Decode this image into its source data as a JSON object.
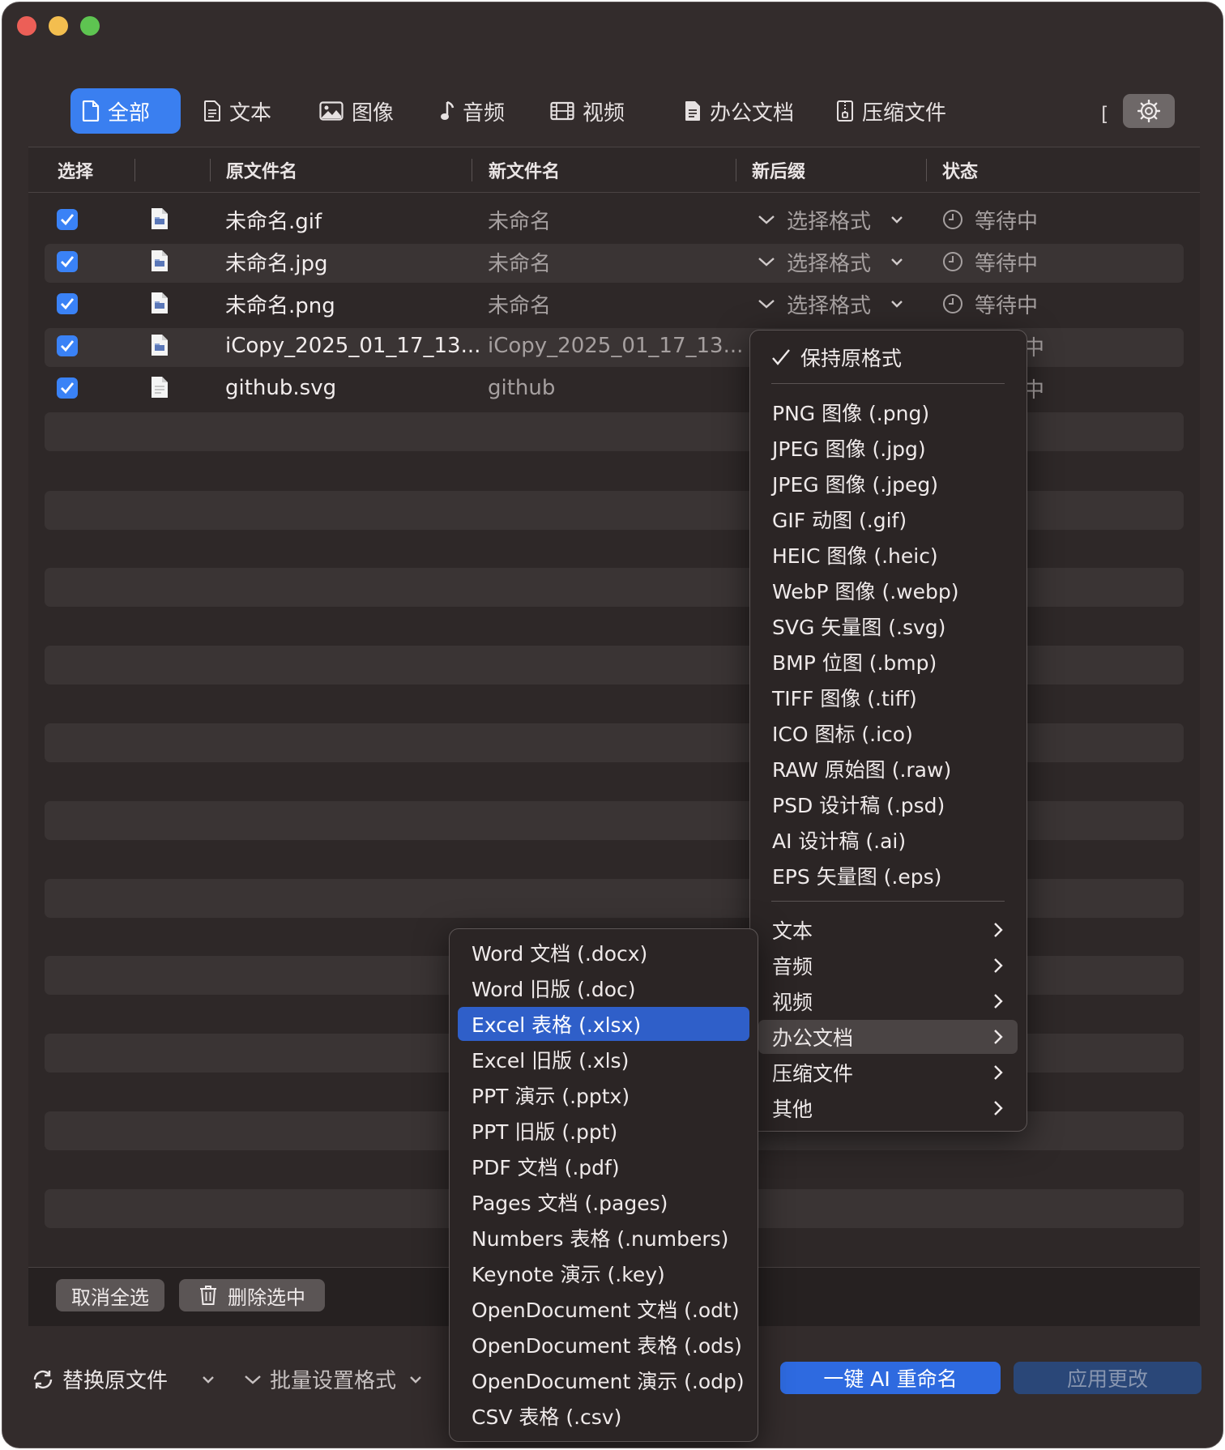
{
  "tabs": [
    {
      "label": "全部",
      "icon": "doc-icon",
      "active": true
    },
    {
      "label": "文本",
      "icon": "text-doc-icon"
    },
    {
      "label": "图像",
      "icon": "image-icon"
    },
    {
      "label": "音频",
      "icon": "music-note-icon"
    },
    {
      "label": "视频",
      "icon": "film-icon"
    },
    {
      "label": "办公文档",
      "icon": "office-doc-icon"
    },
    {
      "label": "压缩文件",
      "icon": "zip-icon"
    }
  ],
  "tab_overflow": "[",
  "columns": {
    "select": "选择",
    "original": "原文件名",
    "new_name": "新文件名",
    "suffix": "新后缀",
    "status": "状态"
  },
  "rows": [
    {
      "checked": true,
      "original": "未命名.gif",
      "new_name": "未命名",
      "suffix": "选择格式",
      "status": "等待中"
    },
    {
      "checked": true,
      "original": "未命名.jpg",
      "new_name": "未命名",
      "suffix": "选择格式",
      "status": "等待中"
    },
    {
      "checked": true,
      "original": "未命名.png",
      "new_name": "未命名",
      "suffix": "选择格式",
      "status": "等待中"
    },
    {
      "checked": true,
      "original": "iCopy_2025_01_17_13...",
      "new_name": "iCopy_2025_01_17_13...",
      "status_partial": "中"
    },
    {
      "checked": true,
      "original": "github.svg",
      "new_name": "github",
      "status_partial": "中"
    }
  ],
  "bottom_bar": {
    "deselect_all": "取消全选",
    "delete_selected": "删除选中"
  },
  "footer": {
    "replace_original": "替换原文件",
    "batch_format": "批量设置格式",
    "ai_rename": "一键 AI 重命名",
    "apply_changes": "应用更改"
  },
  "format_menu": {
    "keep_original": "保持原格式",
    "image_formats": [
      "PNG 图像 (.png)",
      "JPEG 图像 (.jpg)",
      "JPEG 图像 (.jpeg)",
      "GIF 动图 (.gif)",
      "HEIC 图像 (.heic)",
      "WebP 图像 (.webp)",
      "SVG 矢量图 (.svg)",
      "BMP 位图 (.bmp)",
      "TIFF 图像 (.tiff)",
      "ICO 图标 (.ico)",
      "RAW 原始图 (.raw)",
      "PSD 设计稿 (.psd)",
      "AI 设计稿 (.ai)",
      "EPS 矢量图 (.eps)"
    ],
    "categories": [
      "文本",
      "音频",
      "视频",
      "办公文档",
      "压缩文件",
      "其他"
    ],
    "hovered_category": "办公文档"
  },
  "office_submenu": {
    "items": [
      "Word 文档 (.docx)",
      "Word 旧版 (.doc)",
      "Excel 表格 (.xlsx)",
      "Excel 旧版 (.xls)",
      "PPT 演示 (.pptx)",
      "PPT 旧版 (.ppt)",
      "PDF 文档 (.pdf)",
      "Pages 文档 (.pages)",
      "Numbers 表格 (.numbers)",
      "Keynote 演示 (.key)",
      "OpenDocument 文档 (.odt)",
      "OpenDocument 表格 (.ods)",
      "OpenDocument 演示 (.odp)",
      "CSV 表格 (.csv)"
    ],
    "highlighted": "Excel 表格 (.xlsx)"
  },
  "colors": {
    "window_bg": "#332c2c",
    "accent": "#3a7ff0",
    "highlight": "#2f5fc9",
    "text_primary": "#f2eded",
    "text_secondary": "#a6a0a0"
  }
}
